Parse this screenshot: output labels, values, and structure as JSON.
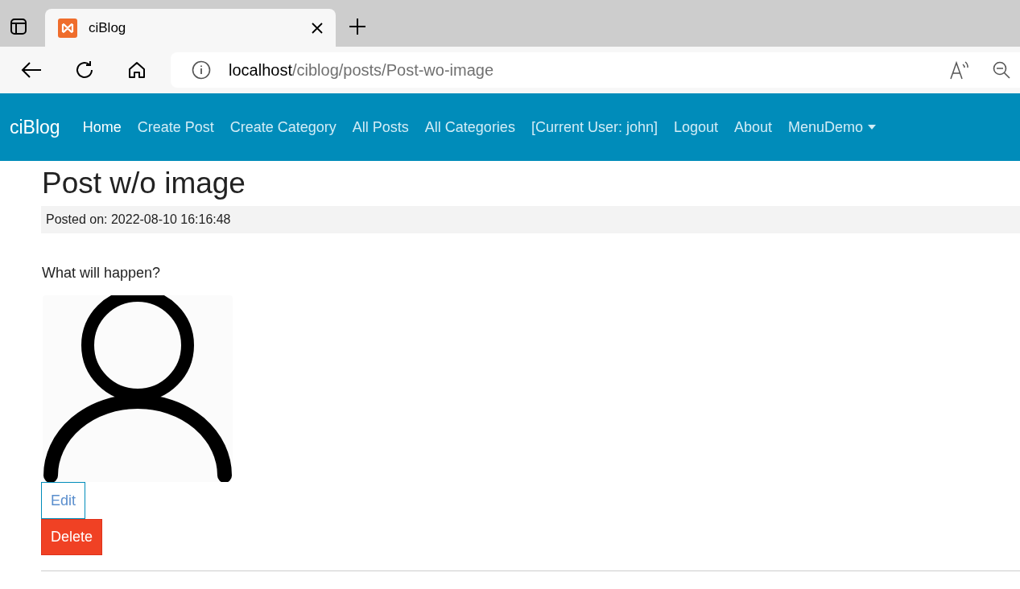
{
  "browser": {
    "tab_title": "ciBlog",
    "url_host": "localhost",
    "url_path": "/ciblog/posts/Post-wo-image"
  },
  "navbar": {
    "brand": "ciBlog",
    "items": [
      {
        "label": "Home",
        "selected": true
      },
      {
        "label": "Create Post",
        "selected": false
      },
      {
        "label": "Create Category",
        "selected": false
      },
      {
        "label": "All Posts",
        "selected": false
      },
      {
        "label": "All Categories",
        "selected": false
      },
      {
        "label": "[Current User: john]",
        "selected": false
      },
      {
        "label": "Logout",
        "selected": false
      },
      {
        "label": "About",
        "selected": false
      },
      {
        "label": "MenuDemo",
        "selected": false,
        "dropdown": true
      }
    ]
  },
  "post": {
    "title": "Post w/o image",
    "posted_on": "Posted on: 2022-08-10 16:16:48",
    "body": "What will happen?",
    "buttons": [
      {
        "label": "Edit",
        "kind": "outline"
      },
      {
        "label": "Delete",
        "kind": "danger"
      }
    ]
  }
}
